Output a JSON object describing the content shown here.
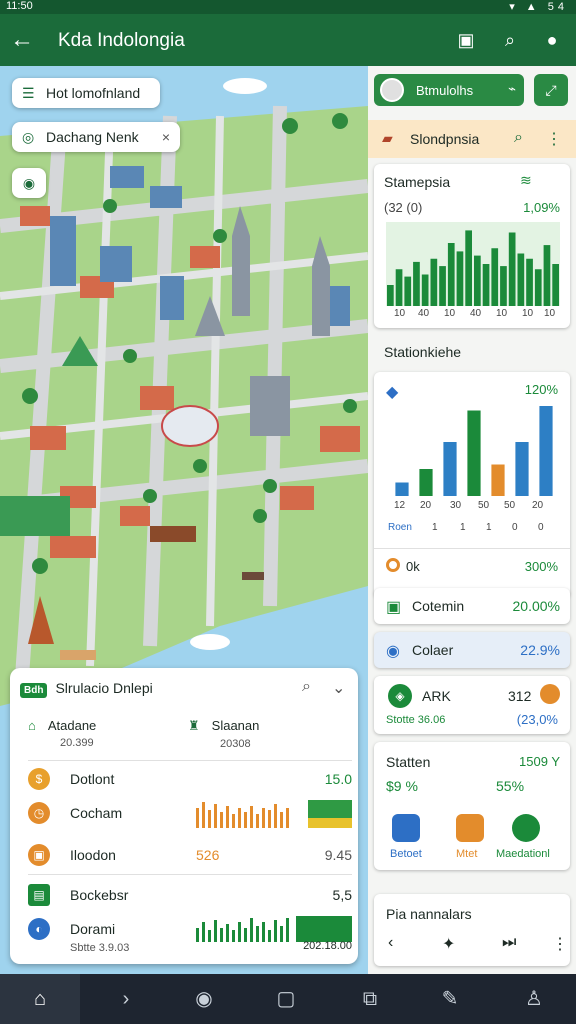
{
  "status": {
    "time": "11:50",
    "battery": "54"
  },
  "appbar": {
    "title": "Kda Indolongia"
  },
  "map": {
    "chip1": "Hot lomofnland",
    "chip2": "Dachang Nenk"
  },
  "bottom_card": {
    "badge": "Bdh",
    "title": "Slrulacio Dnlepi",
    "cell_a": {
      "label": "Atadane",
      "sub": "20.399"
    },
    "cell_b": {
      "label": "Slaanan",
      "sub": "20308"
    },
    "rows": [
      {
        "label": "Dotlont",
        "value": "15.0"
      },
      {
        "label": "Cocham",
        "value": ""
      },
      {
        "label": "Iloodon",
        "value": "9.45",
        "mid": "526"
      },
      {
        "label": "Bockebsr",
        "value": "5,5"
      },
      {
        "label": "Dorami",
        "value": "202.18.00",
        "sub": "Sbtte 3.9.03"
      }
    ]
  },
  "right": {
    "profile": "Btmulolhs",
    "header": "Slondpnsia",
    "c1": {
      "title": "Stamepsia",
      "sub": "(32 (0)",
      "value": "1,09%",
      "ticks": [
        "10",
        "40",
        "10",
        "40",
        "10",
        "10",
        "10"
      ]
    },
    "section": "Stationkiehe",
    "c2": {
      "value": "120%",
      "xticks": [
        "12",
        "20",
        "30",
        "50",
        "50",
        "20"
      ],
      "yticks": [
        "Roen",
        "1",
        "1",
        "1",
        "0",
        "0"
      ],
      "foot_left": "0k",
      "foot_right": "300%"
    },
    "c3": {
      "label": "Cotemin",
      "value": "20.00%"
    },
    "c4": {
      "label": "Colaer",
      "value": "22.9%"
    },
    "c5": {
      "label": "ARK",
      "value": "312",
      "sub": "Stotte 36.06",
      "sub_value": "(23,0%"
    },
    "c6": {
      "label": "Statten",
      "value": "1509 Y",
      "v1": "$9 %",
      "v2": "55%",
      "actions": [
        "Betoet",
        "Mtet",
        "Maedationl"
      ]
    },
    "c7": {
      "label": "Pia nannalars"
    }
  },
  "chart_data": [
    {
      "type": "bar",
      "title": "Stamepsia",
      "x": [
        "10",
        "40",
        "10",
        "40",
        "10",
        "10",
        "10"
      ],
      "series": [
        {
          "values": [
            20,
            35,
            28,
            42,
            30,
            45,
            38,
            60,
            52,
            72,
            48,
            40,
            55,
            38,
            70,
            50,
            45,
            35,
            58,
            40
          ]
        }
      ],
      "ylim": [
        0,
        80
      ]
    },
    {
      "type": "bar",
      "categories": [
        "12",
        "20",
        "30",
        "50",
        "50",
        "20"
      ],
      "values": [
        15,
        30,
        60,
        95,
        35,
        60,
        100
      ],
      "colors": [
        "#2d7fc5",
        "#1b8a3a",
        "#2d7fc5",
        "#1b8a3a",
        "#e38c2c",
        "#2d7fc5"
      ],
      "ylim": [
        0,
        100
      ]
    }
  ],
  "colors": {
    "primary": "#1b6b3a",
    "accent": "#1b8a3a",
    "blue": "#2d7fc5",
    "orange": "#e38c2c"
  }
}
